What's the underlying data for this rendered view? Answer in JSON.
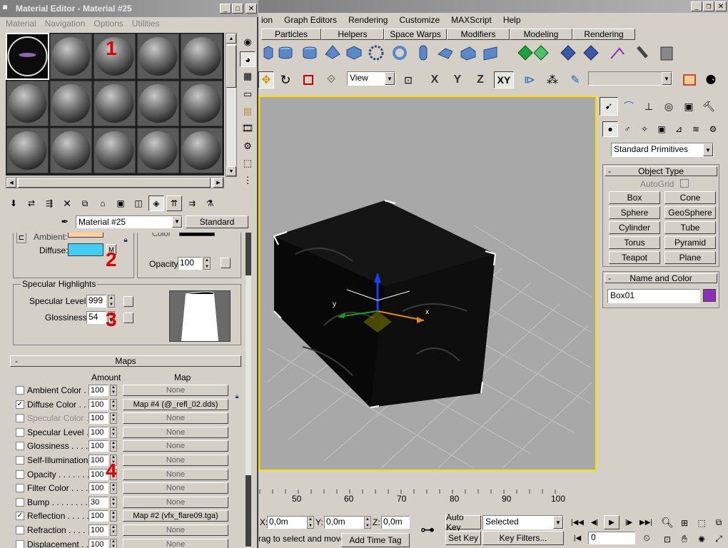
{
  "max": {
    "menu": [
      "ion",
      "Graph Editors",
      "Rendering",
      "Customize",
      "MAXScript",
      "Help"
    ],
    "tabs": [
      "Particles",
      "Helpers",
      "Space Warps",
      "Modifiers",
      "Modeling",
      "Rendering"
    ],
    "view_dropdown": "View",
    "axis_labels": [
      "X",
      "Y",
      "Z",
      "XY"
    ],
    "ruler_labels": [
      "50",
      "60",
      "70",
      "80",
      "90",
      "100"
    ],
    "gizmo_labels": {
      "x": "x",
      "y": "y"
    },
    "command_panel": {
      "category": "Standard Primitives",
      "object_type_title": "Object Type",
      "autogrid": "AutoGrid",
      "buttons": [
        "Box",
        "Cone",
        "Sphere",
        "GeoSphere",
        "Cylinder",
        "Tube",
        "Torus",
        "Pyramid",
        "Teapot",
        "Plane"
      ],
      "name_color_title": "Name and Color",
      "object_name": "Box01",
      "object_color": "#8a2fb8"
    },
    "status": {
      "x_label": "X:",
      "x_value": "0,0m",
      "y_label": "Y:",
      "y_value": "0,0m",
      "z_label": "Z:",
      "z_value": "0,0m",
      "prompt": "rag to select and move",
      "add_time_tag": "Add Time Tag",
      "auto_key": "Auto Key",
      "set_key": "Set Key",
      "selected": "Selected",
      "key_filters": "Key Filters...",
      "frame": "0"
    }
  },
  "mat": {
    "title": "Material Editor - Material #25",
    "menu": [
      "Material",
      "Navigation",
      "Options",
      "Utilities"
    ],
    "material_name": "Material #25",
    "material_type": "Standard",
    "basic": {
      "ambient": "Ambient:",
      "diffuse": "Diffuse:",
      "m_label": "M",
      "color_label": "Color",
      "opacity_label": "Opacity:",
      "opacity_value": "100",
      "diffuse_color": "#44ccf4",
      "ambient_color": "#fdcf9a"
    },
    "specular": {
      "group": "Specular Highlights",
      "level_label": "Specular Level:",
      "level_value": "999",
      "gloss_label": "Glossiness:",
      "gloss_value": "54"
    },
    "maps": {
      "title": "Maps",
      "col_amount": "Amount",
      "col_map": "Map",
      "rows": [
        {
          "label": "Ambient Color . . .",
          "amount": "100",
          "map": "None",
          "checked": false,
          "disabled": false
        },
        {
          "label": "Diffuse Color . . . .",
          "amount": "100",
          "map": "Map #4 (@_refl_02.dds)",
          "checked": true,
          "disabled": false
        },
        {
          "label": "Specular Color . . .",
          "amount": "100",
          "map": "None",
          "checked": false,
          "disabled": true
        },
        {
          "label": "Specular Level . .",
          "amount": "100",
          "map": "None",
          "checked": false,
          "disabled": false
        },
        {
          "label": "Glossiness . . . . .",
          "amount": "100",
          "map": "None",
          "checked": false,
          "disabled": false
        },
        {
          "label": "Self-Illumination . .",
          "amount": "100",
          "map": "None",
          "checked": false,
          "disabled": false
        },
        {
          "label": "Opacity . . . . . . . .",
          "amount": "100",
          "map": "None",
          "checked": false,
          "disabled": false
        },
        {
          "label": "Filter Color . . . . .",
          "amount": "100",
          "map": "None",
          "checked": false,
          "disabled": false
        },
        {
          "label": "Bump . . . . . . . . .",
          "amount": "30",
          "map": "None",
          "checked": false,
          "disabled": false
        },
        {
          "label": "Reflection . . . . .",
          "amount": "100",
          "map": "Map #2 (vfx_flare09.tga)",
          "checked": true,
          "disabled": false
        },
        {
          "label": "Refraction . . . . .",
          "amount": "100",
          "map": "None",
          "checked": false,
          "disabled": false
        },
        {
          "label": "Displacement . . .",
          "amount": "100",
          "map": "None",
          "checked": false,
          "disabled": false
        }
      ]
    },
    "annotations": [
      "1",
      "2",
      "3",
      "4"
    ]
  }
}
